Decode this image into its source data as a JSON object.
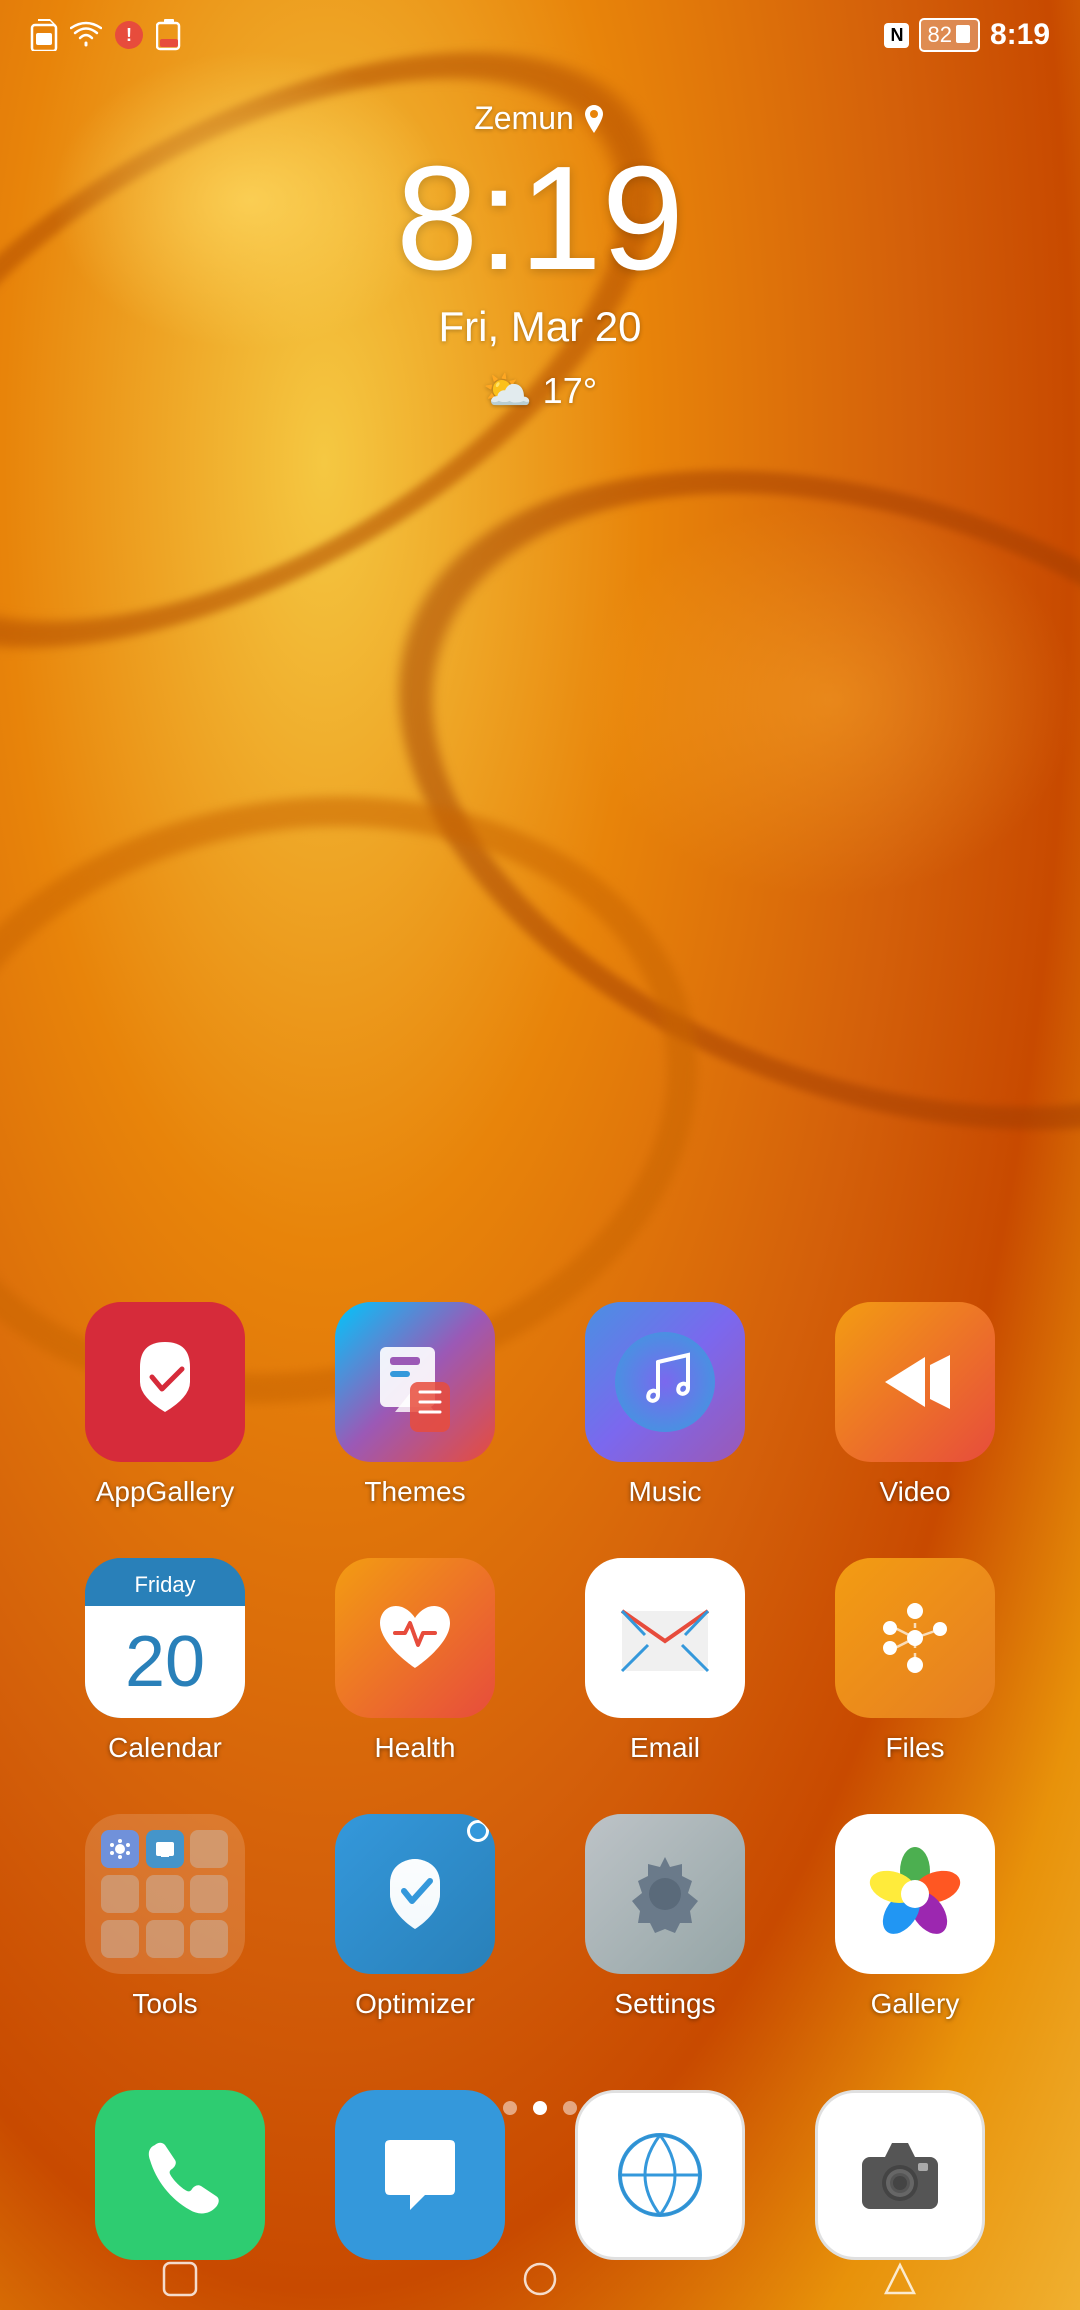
{
  "statusBar": {
    "time": "8:19",
    "battery": "82",
    "nfc": "N",
    "icons": [
      "sim",
      "wifi",
      "notify",
      "battery"
    ]
  },
  "clock": {
    "location": "Zemun",
    "time": "8:19",
    "date": "Fri, Mar 20",
    "weather": "17°"
  },
  "apps": {
    "row1": [
      {
        "id": "appgallery",
        "label": "AppGallery"
      },
      {
        "id": "themes",
        "label": "Themes"
      },
      {
        "id": "music",
        "label": "Music"
      },
      {
        "id": "video",
        "label": "Video"
      }
    ],
    "row2": [
      {
        "id": "calendar",
        "label": "Calendar",
        "day": "20",
        "dayName": "Friday"
      },
      {
        "id": "health",
        "label": "Health"
      },
      {
        "id": "email",
        "label": "Email"
      },
      {
        "id": "files",
        "label": "Files"
      }
    ],
    "row3": [
      {
        "id": "tools",
        "label": "Tools"
      },
      {
        "id": "optimizer",
        "label": "Optimizer"
      },
      {
        "id": "settings",
        "label": "Settings"
      },
      {
        "id": "gallery",
        "label": "Gallery"
      }
    ]
  },
  "dock": [
    {
      "id": "phone",
      "label": ""
    },
    {
      "id": "messages",
      "label": ""
    },
    {
      "id": "browser",
      "label": ""
    },
    {
      "id": "camera",
      "label": ""
    }
  ],
  "pageIndicators": [
    false,
    true,
    false
  ],
  "nav": {
    "square": "⬜",
    "circle": "⬤",
    "triangle": "◁"
  }
}
